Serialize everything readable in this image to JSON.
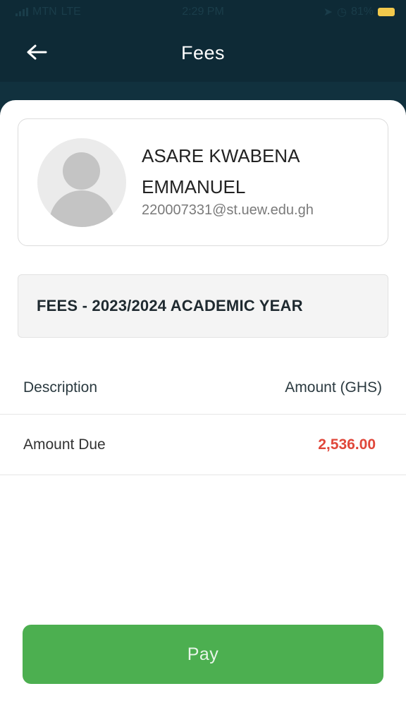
{
  "status_bar": {
    "carrier": "MTN",
    "network": "LTE",
    "time": "2:29 PM",
    "battery": "81%",
    "battery_color": "#f2c94c"
  },
  "header": {
    "title": "Fees",
    "back_icon": "arrow-left-icon"
  },
  "profile": {
    "name": "ASARE KWABENA EMMANUEL",
    "email": "220007331@st.uew.edu.gh",
    "avatar_icon": "user-avatar-icon"
  },
  "fees": {
    "banner": "FEES - 2023/2024 ACADEMIC YEAR",
    "columns": [
      "Description",
      "Amount (GHS)"
    ],
    "rows": [
      {
        "description": "Amount Due",
        "amount": "2,536.00"
      }
    ],
    "amount_color": "#e0473a"
  },
  "actions": {
    "pay_label": "Pay",
    "pay_color": "#4caf50"
  },
  "colors": {
    "primary_dark": "#0e2a36"
  }
}
